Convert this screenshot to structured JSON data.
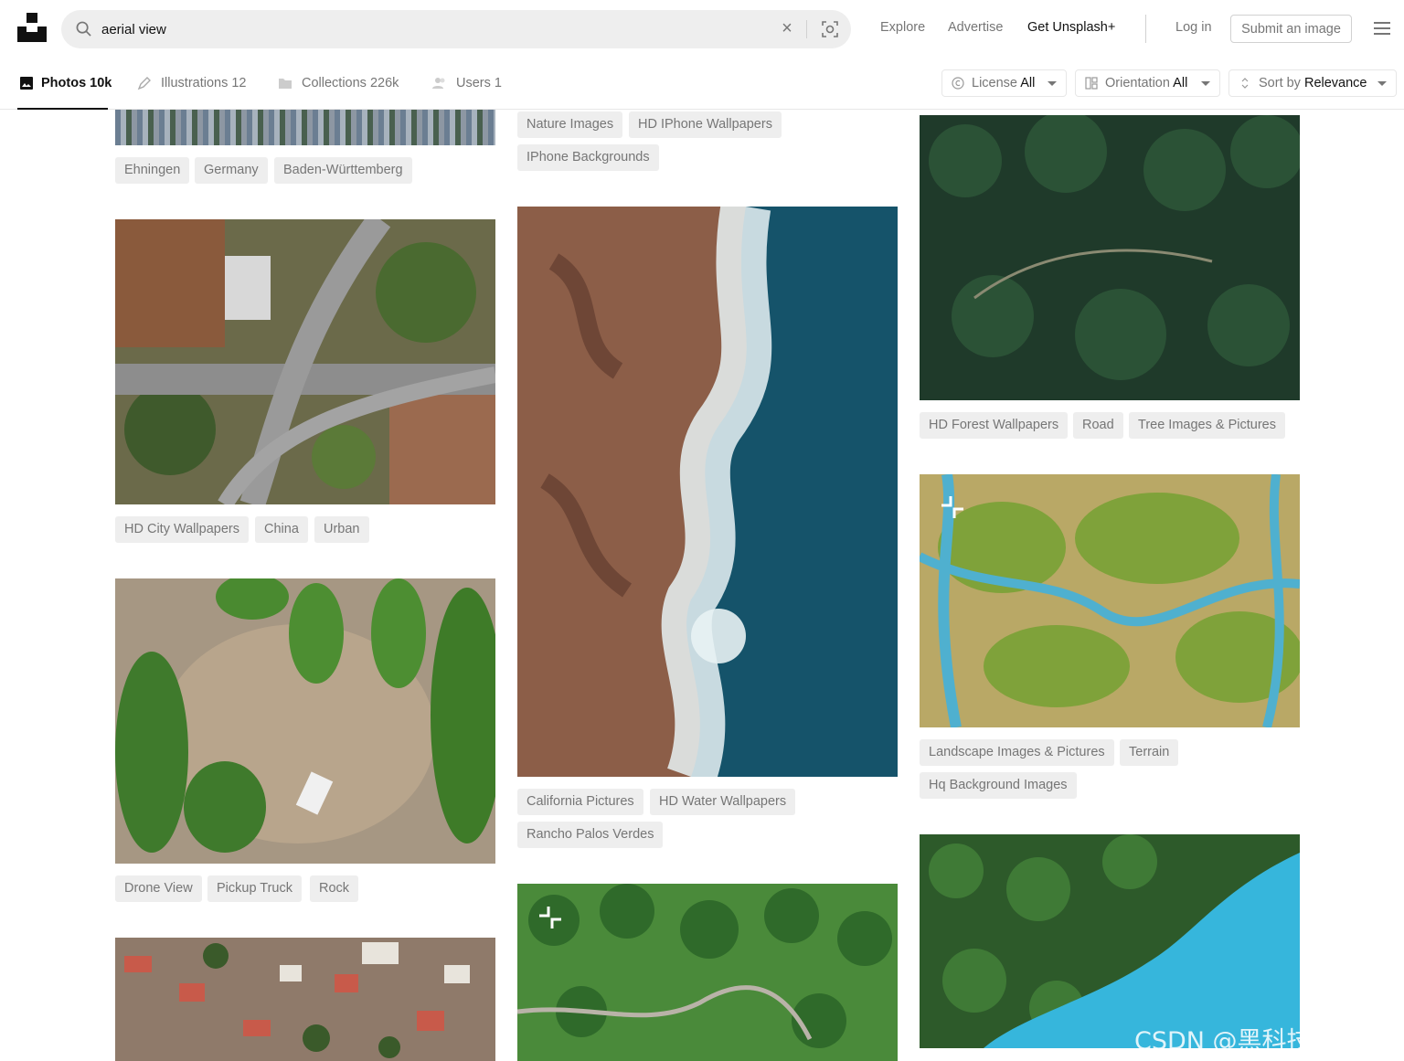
{
  "header": {
    "search_value": "aerial view",
    "nav": {
      "explore": "Explore",
      "advertise": "Advertise",
      "get_plus": "Get Unsplash+"
    },
    "login": "Log in",
    "submit": "Submit an image"
  },
  "subnav": {
    "tabs": [
      {
        "label": "Photos 10k",
        "icon": "image-icon"
      },
      {
        "label": "Illustrations 12",
        "icon": "pen-icon"
      },
      {
        "label": "Collections 226k",
        "icon": "folder-icon"
      },
      {
        "label": "Users 1",
        "icon": "users-icon"
      }
    ],
    "filters": [
      {
        "label": "License",
        "value": "All",
        "icon": "copyright-icon"
      },
      {
        "label": "Orientation",
        "value": "All",
        "icon": "layout-icon"
      },
      {
        "label": "Sort by",
        "value": "Relevance",
        "icon": "sort-icon"
      }
    ]
  },
  "photos": {
    "col1": [
      {
        "tags": [
          "Ehningen",
          "Germany",
          "Baden-Württemberg"
        ]
      },
      {
        "tags": [
          "HD City Wallpapers",
          "China",
          "Urban"
        ]
      },
      {
        "tags": [
          "Drone View",
          "Pickup Truck",
          "Rock"
        ]
      }
    ],
    "col2": [
      {
        "tags": [
          "Nature Images",
          "HD IPhone Wallpapers",
          "IPhone Backgrounds"
        ]
      },
      {
        "tags": [
          "California Pictures",
          "HD Water Wallpapers",
          "Rancho Palos Verdes"
        ]
      }
    ],
    "col3": [
      {
        "tags": [
          "HD Forest Wallpapers",
          "Road",
          "Tree Images & Pictures"
        ]
      },
      {
        "tags": [
          "Landscape Images & Pictures",
          "Terrain",
          "Hq Background Images"
        ]
      }
    ]
  },
  "watermark": "CSDN @黑科技研究僧",
  "colors": {
    "text": "#111111",
    "muted": "#767676",
    "tag_bg": "#eeeeee"
  }
}
